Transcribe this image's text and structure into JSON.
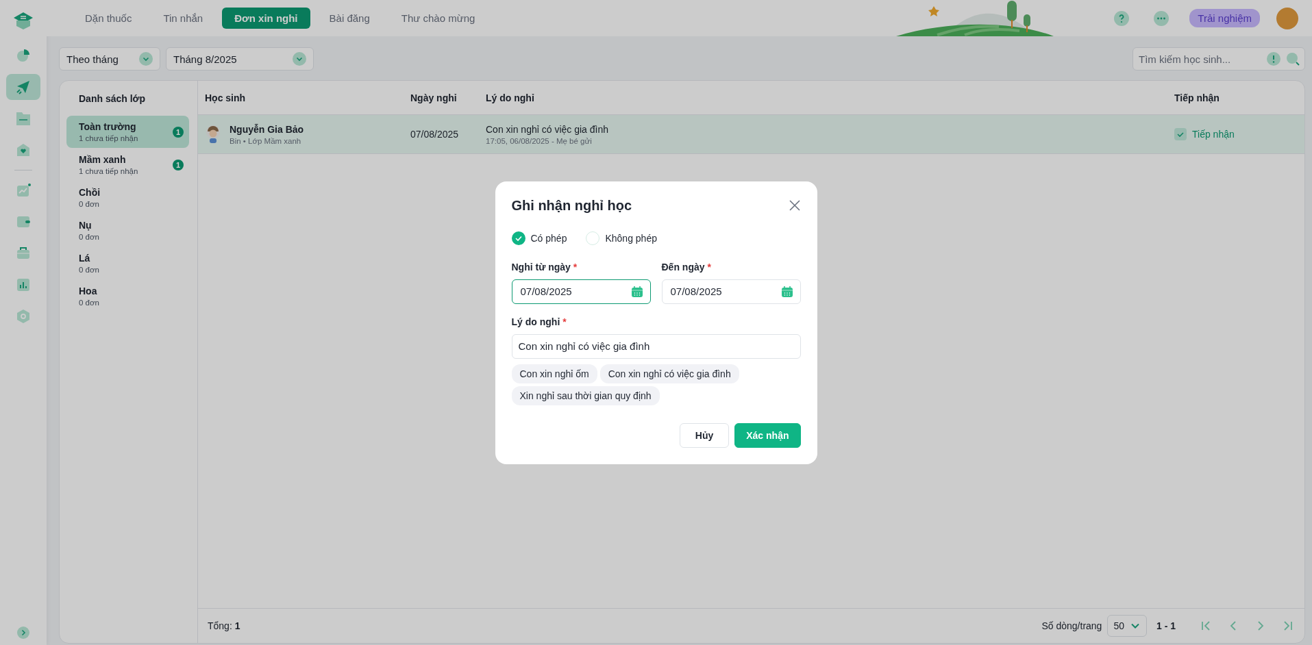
{
  "sidebar": {
    "items": [
      {
        "selected": false
      },
      {
        "selected": true
      },
      {
        "selected": false
      },
      {
        "selected": false
      },
      {
        "selected": false
      },
      {
        "selected": false
      },
      {
        "selected": false
      },
      {
        "selected": false
      },
      {
        "selected": false
      }
    ]
  },
  "tabs": [
    {
      "label": "Dặn thuốc",
      "selected": false
    },
    {
      "label": "Tin nhắn",
      "selected": false
    },
    {
      "label": "Đơn xin nghỉ",
      "selected": true
    },
    {
      "label": "Bài đăng",
      "selected": false
    },
    {
      "label": "Thư chào mừng",
      "selected": false
    }
  ],
  "header": {
    "trial_button": "Trải nghiệm"
  },
  "filters": {
    "period": "Theo tháng",
    "month": "Tháng 8/2025"
  },
  "search": {
    "placeholder": "Tìm kiếm học sinh..."
  },
  "class_list": {
    "title": "Danh sách lớp",
    "items": [
      {
        "name": "Toàn trường",
        "subtitle": "1 chưa tiếp nhận",
        "badge": "1",
        "selected": true
      },
      {
        "name": "Mầm xanh",
        "subtitle": "1 chưa tiếp nhận",
        "badge": "1",
        "selected": false
      },
      {
        "name": "Chồi",
        "subtitle": "0 đơn",
        "selected": false
      },
      {
        "name": "Nụ",
        "subtitle": "0 đơn",
        "selected": false
      },
      {
        "name": "Lá",
        "subtitle": "0 đơn",
        "selected": false
      },
      {
        "name": "Hoa",
        "subtitle": "0 đơn",
        "selected": false
      }
    ]
  },
  "table": {
    "columns": [
      "Học sinh",
      "Ngày nghỉ",
      "Lý do nghỉ",
      "Tiếp nhận"
    ],
    "rows": [
      {
        "name": "Nguyễn Gia Bảo",
        "meta": "Bin • Lớp Mầm xanh",
        "date": "07/08/2025",
        "reason": "Con xin nghỉ có việc gia đình",
        "sent": "17:05, 06/08/2025 - Mẹ bé gửi",
        "status": "Tiếp nhận",
        "accepted": true,
        "selected": true
      }
    ]
  },
  "footer": {
    "total": "Tổng: **1**",
    "rows_per_page_label": "Số dòng/trang",
    "page_size": "50",
    "range": "1 - 1"
  },
  "dialog": {
    "title": "Ghi nhận nghỉ học",
    "options": [
      {
        "label": "Có phép",
        "selected": true
      },
      {
        "label": "Không phép",
        "selected": false
      }
    ],
    "date_fields": [
      {
        "label": "Nghỉ từ ngày",
        "required_mark": "*",
        "value": "07/08/2025",
        "focused": true
      },
      {
        "label": "Đến ngày",
        "required_mark": "*",
        "value": "07/08/2025",
        "focused": false
      }
    ],
    "reason_field": {
      "label": "Lý do nghỉ",
      "required_mark": "*",
      "value": "Con xin nghỉ có việc gia đình"
    },
    "suggestions": [
      "Con xin nghỉ ốm",
      "Con xin nghỉ có việc gia đình",
      "Xin nghỉ sau thời gian quy định"
    ],
    "cancel_button": "Hủy",
    "confirm_button": "Xác nhận"
  }
}
